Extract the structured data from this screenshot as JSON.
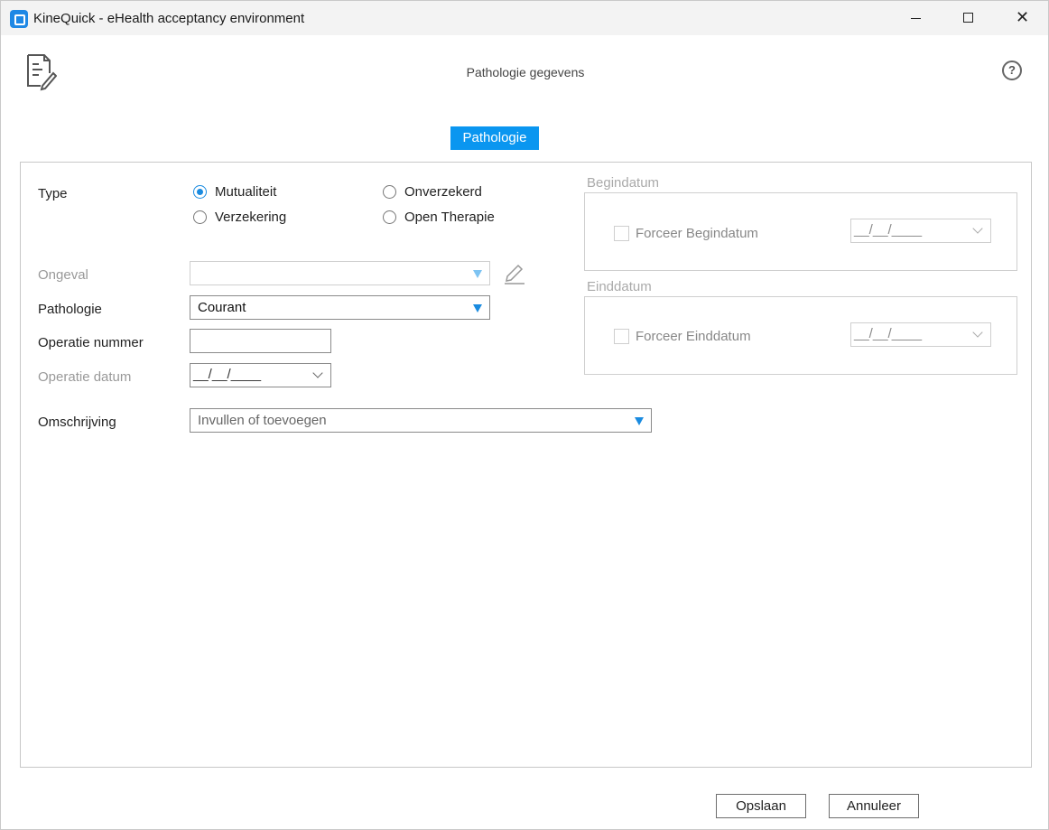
{
  "window": {
    "title": "KineQuick - eHealth acceptancy environment"
  },
  "header": {
    "title": "Pathologie gegevens",
    "help_glyph": "?"
  },
  "tabs": [
    {
      "label": "Pathologie",
      "active": true
    }
  ],
  "form": {
    "type": {
      "label": "Type",
      "options": [
        {
          "label": "Mutualiteit",
          "selected": true
        },
        {
          "label": "Verzekering",
          "selected": false
        },
        {
          "label": "Onverzekerd",
          "selected": false
        },
        {
          "label": "Open Therapie",
          "selected": false
        }
      ]
    },
    "ongeval": {
      "label": "Ongeval",
      "value": ""
    },
    "pathologie": {
      "label": "Pathologie",
      "value": "Courant"
    },
    "operatie_nummer": {
      "label": "Operatie nummer",
      "value": ""
    },
    "operatie_datum": {
      "label": "Operatie datum",
      "value": "__/__/____"
    },
    "omschrijving": {
      "label": "Omschrijving",
      "value": "Invullen of toevoegen"
    }
  },
  "begindatum": {
    "title": "Begindatum",
    "checkbox_label": "Forceer Begindatum",
    "checked": false,
    "value": "__/__/____"
  },
  "einddatum": {
    "title": "Einddatum",
    "checkbox_label": "Forceer Einddatum",
    "checked": false,
    "value": "__/__/____"
  },
  "buttons": {
    "save": "Opslaan",
    "cancel": "Annuleer"
  },
  "colors": {
    "accent": "#0a96f0",
    "radio_selected": "#1a8be0"
  }
}
